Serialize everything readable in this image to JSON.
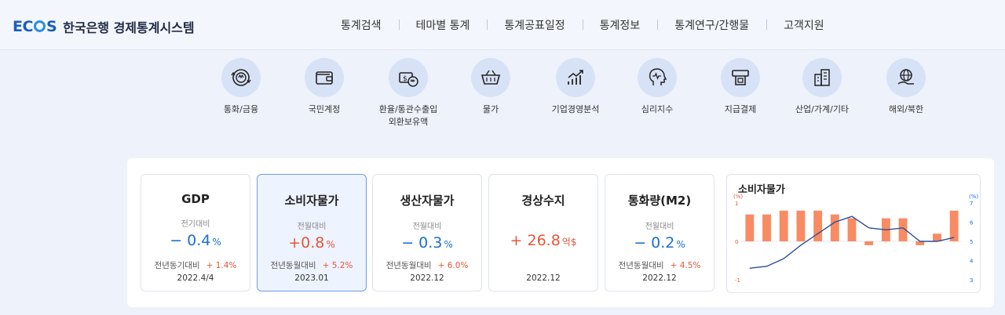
{
  "header": {
    "logo_text": "ECOS",
    "site_name": "한국은행 경제통계시스템",
    "nav": [
      "통계검색",
      "테마별 통계",
      "통계공표일정",
      "통계정보",
      "통계연구/간행물",
      "고객지원"
    ]
  },
  "categories": [
    {
      "label": "통화/금융",
      "icon": "currency-exchange-icon"
    },
    {
      "label": "국민계정",
      "icon": "wallet-icon"
    },
    {
      "label": "환율/통관수출입\n외환보유액",
      "icon": "money-exchange-icon"
    },
    {
      "label": "물가",
      "icon": "basket-icon"
    },
    {
      "label": "기업경영분석",
      "icon": "growth-chart-icon"
    },
    {
      "label": "심리지수",
      "icon": "head-pulse-icon"
    },
    {
      "label": "지급결제",
      "icon": "atm-icon"
    },
    {
      "label": "산업/가계/기타",
      "icon": "building-icon"
    },
    {
      "label": "해외/북한",
      "icon": "globe-hand-icon"
    }
  ],
  "cards": [
    {
      "title": "GDP",
      "sub": "전기대비",
      "sign": "−",
      "value": "0.4",
      "unit": "%",
      "color": "blue",
      "yoy_label": "전년동기대비",
      "yoy": "+ 1.4%",
      "date": "2022.4/4"
    },
    {
      "title": "소비자물가",
      "sub": "전월대비",
      "sign": "+",
      "value": "0.8",
      "unit": "%",
      "color": "red",
      "yoy_label": "전년동월대비",
      "yoy": "+ 5.2%",
      "date": "2023.01"
    },
    {
      "title": "생산자물가",
      "sub": "전월대비",
      "sign": "−",
      "value": "0.3",
      "unit": "%",
      "color": "blue",
      "yoy_label": "전년동월대비",
      "yoy": "+ 6.0%",
      "date": "2022.12"
    },
    {
      "title": "경상수지",
      "sub": "",
      "sign": "+",
      "value": "26.8",
      "unit": "억$",
      "color": "red",
      "yoy_label": "",
      "yoy": "",
      "date": "2022.12"
    },
    {
      "title": "통화량(M2)",
      "sub": "전월대비",
      "sign": "−",
      "value": "0.2",
      "unit": "%",
      "color": "blue",
      "yoy_label": "전년동월대비",
      "yoy": "+ 4.5%",
      "date": "2022.12"
    }
  ],
  "colors": {
    "accent_blue": "#1a6fd4",
    "accent_red": "#e8553a",
    "bar": "#f88b63",
    "line": "#2a4f9a"
  },
  "chart_data": {
    "type": "bar",
    "title": "소비자물가",
    "left_axis": {
      "unit": "(%)",
      "ticks": [
        "1",
        "0",
        "-1"
      ],
      "range": [
        -1,
        1
      ]
    },
    "right_axis": {
      "unit": "(%)",
      "ticks": [
        "7",
        "6",
        "5",
        "4",
        "3"
      ],
      "range": [
        3,
        7
      ]
    },
    "series": [
      {
        "type": "bar",
        "axis": "left",
        "values": [
          0.7,
          0.7,
          0.8,
          0.8,
          0.8,
          0.7,
          0.6,
          -0.1,
          0.6,
          0.6,
          -0.1,
          0.2,
          0.8
        ]
      },
      {
        "type": "line",
        "axis": "right",
        "values": [
          3.6,
          3.7,
          4.1,
          4.8,
          5.4,
          6.0,
          6.3,
          5.7,
          5.6,
          5.7,
          5.0,
          5.0,
          5.2
        ]
      }
    ]
  }
}
